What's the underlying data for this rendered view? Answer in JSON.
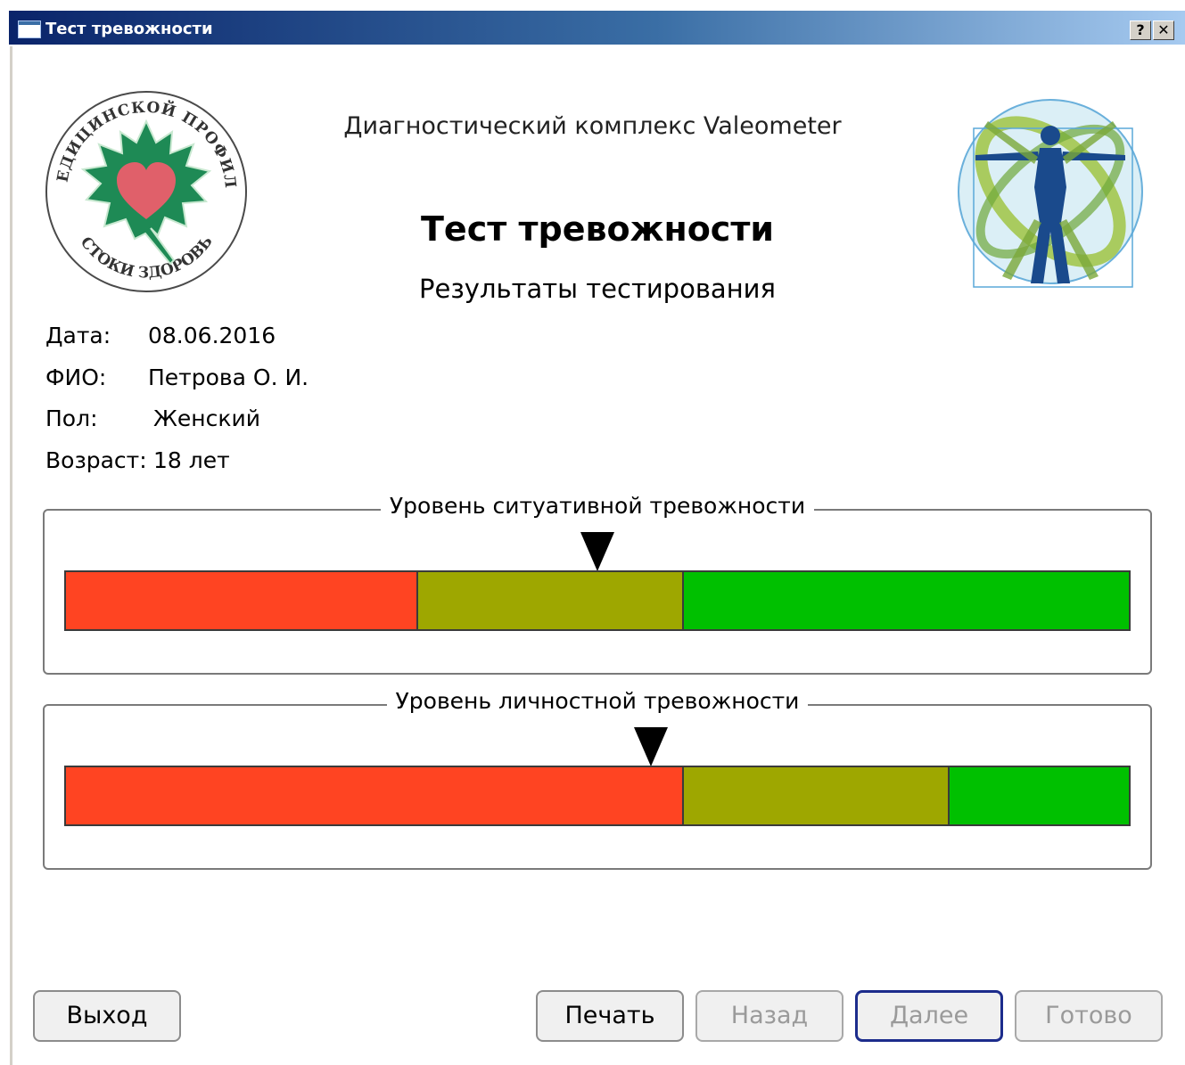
{
  "window": {
    "title": "Тест тревожности",
    "help_label": "?",
    "close_label": "✕"
  },
  "header": {
    "subtitle": "Диагностический комплекс Valeometer",
    "title": "Тест тревожности",
    "results_title": "Результаты тестирования"
  },
  "logos": {
    "left_text_top": "ЦЕНТР МЕДИЦИНСКОЙ ПРОФИЛАКТИКИ",
    "left_text_bottom": "«ИСТОКИ ЗДОРОВЬЯ»",
    "left_colors": {
      "leaf": "#1e8a55",
      "heart": "#e0606a"
    },
    "right_icon": "vitruvian-man-icon"
  },
  "patient": {
    "date_label": "Дата:",
    "date_value": "08.06.2016",
    "name_label": "ФИО:",
    "name_value": "Петрова О. И.",
    "sex_label": "Пол:",
    "sex_value": "Женский",
    "age_label": "Возраст:",
    "age_value": "18 лет"
  },
  "scales": [
    {
      "label": "Уровень ситуативной тревожности",
      "segments": [
        {
          "level": "high",
          "fraction": 0.33,
          "color": "#ff4422"
        },
        {
          "level": "mid",
          "fraction": 0.25,
          "color": "#9ea700"
        },
        {
          "level": "low",
          "fraction": 0.42,
          "color": "#00c000"
        }
      ],
      "marker_fraction": 0.5
    },
    {
      "label": "Уровень личностной тревожности",
      "segments": [
        {
          "level": "high",
          "fraction": 0.58,
          "color": "#ff4422"
        },
        {
          "level": "mid",
          "fraction": 0.25,
          "color": "#9ea700"
        },
        {
          "level": "low",
          "fraction": 0.17,
          "color": "#00c000"
        }
      ],
      "marker_fraction": 0.55
    }
  ],
  "buttons": {
    "exit": "Выход",
    "print": "Печать",
    "back": "Назад",
    "next": "Далее",
    "done": "Готово"
  }
}
